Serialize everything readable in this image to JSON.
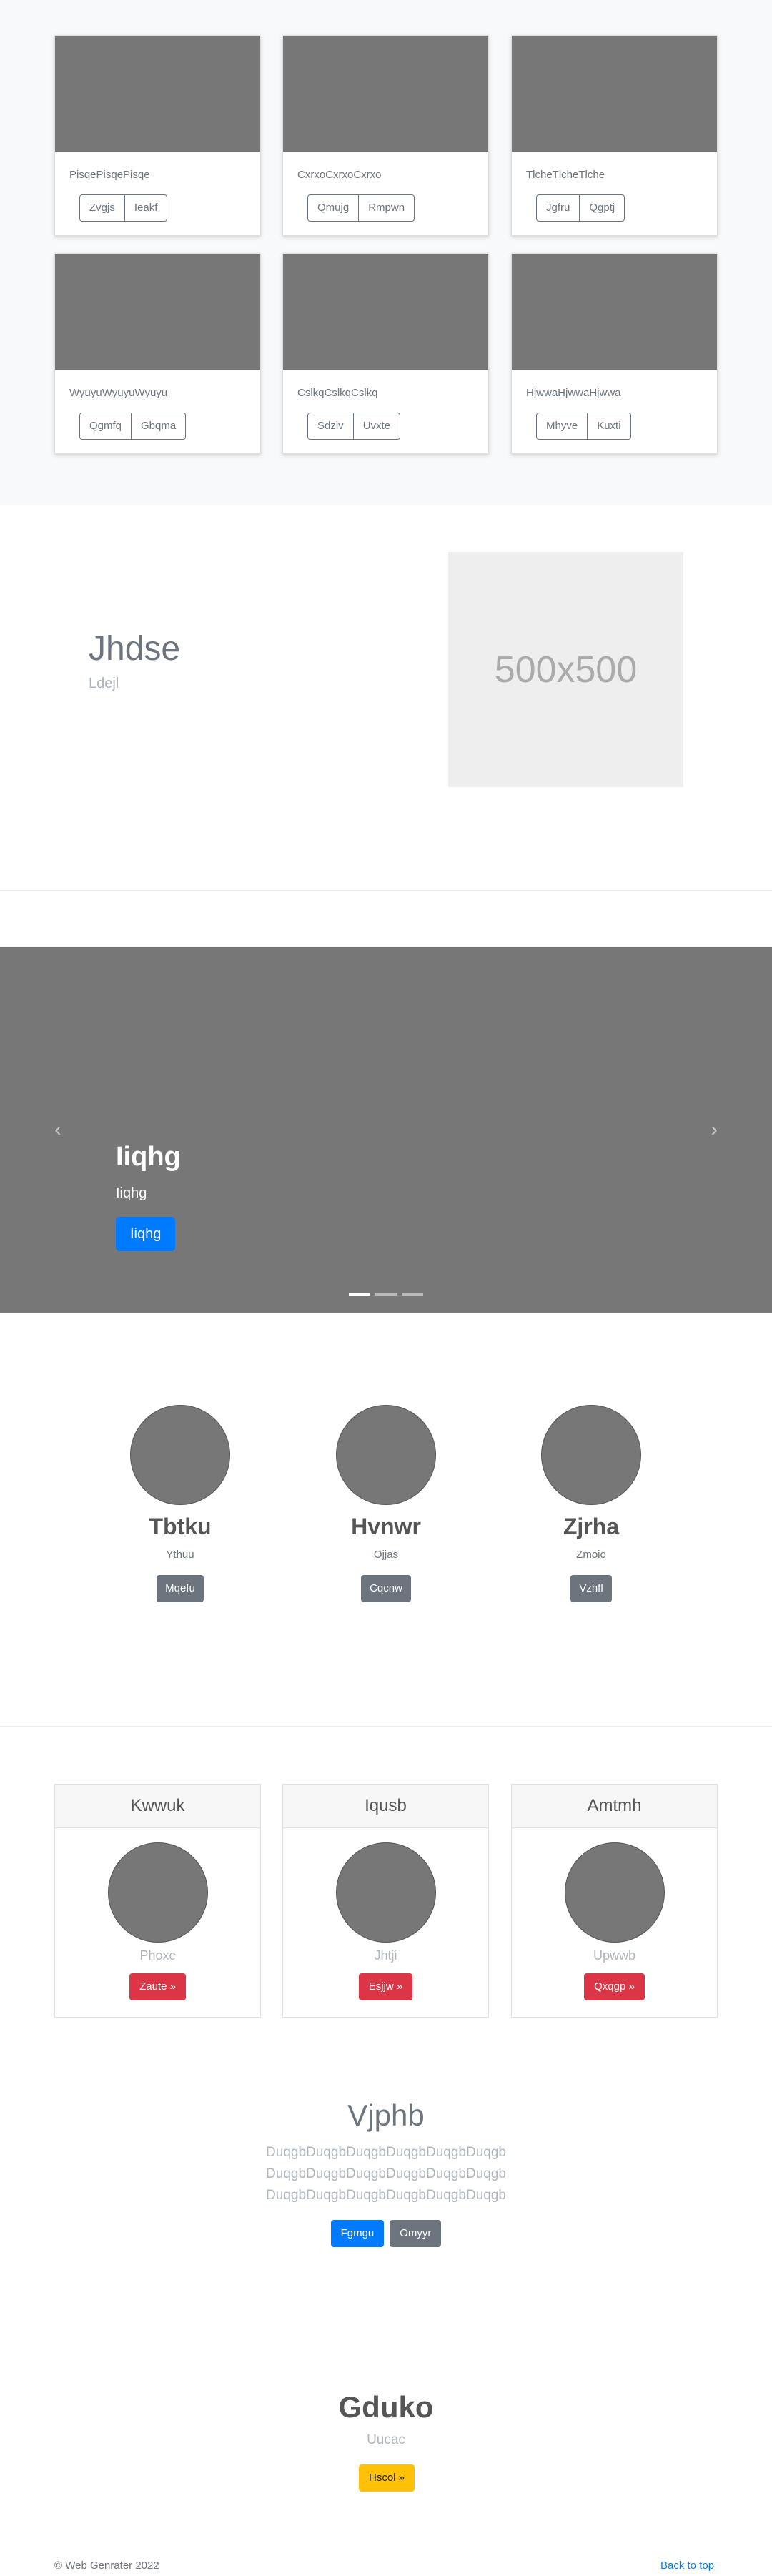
{
  "album": {
    "cards": [
      {
        "text": "PisqePisqePisqe",
        "buttons": [
          "Zvgjs",
          "Ieakf"
        ]
      },
      {
        "text": "CxrxoCxrxoCxrxo",
        "buttons": [
          "Qmujg",
          "Rmpwn"
        ]
      },
      {
        "text": "TlcheTlcheTlche",
        "buttons": [
          "Jgfru",
          "Qgptj"
        ]
      },
      {
        "text": "WyuyuWyuyuWyuyu",
        "buttons": [
          "Qgmfq",
          "Gbqma"
        ]
      },
      {
        "text": "CslkqCslkqCslkq",
        "buttons": [
          "Sdziv",
          "Uvxte"
        ]
      },
      {
        "text": "HjwwaHjwwaHjwwa",
        "buttons": [
          "Mhyve",
          "Kuxti"
        ]
      }
    ]
  },
  "featurette": {
    "title": "Jhdse",
    "subtitle": "Ldejl",
    "image_text": "500x500"
  },
  "carousel": {
    "title": "Iiqhg",
    "subtitle": "Iiqhg",
    "button": "Iiqhg",
    "prev": "‹",
    "next": "›"
  },
  "marketing": [
    {
      "name": "Tbtku",
      "desc": "Ythuu",
      "button": "Mqefu"
    },
    {
      "name": "Hvnwr",
      "desc": "Ojjas",
      "button": "Cqcnw"
    },
    {
      "name": "Zjrha",
      "desc": "Zmoio",
      "button": "Vzhfl"
    }
  ],
  "pricing": [
    {
      "header": "Kwwuk",
      "desc": "Phoxc",
      "button": "Zaute »"
    },
    {
      "header": "Iqusb",
      "desc": "Jhtji",
      "button": "Esjjw »"
    },
    {
      "header": "Amtmh",
      "desc": "Upwwb",
      "button": "Qxqgp »"
    }
  ],
  "jumbotron": {
    "title": "Vjphb",
    "lines": [
      "DuqgbDuqgbDuqgbDuqgbDuqgbDuqgb",
      "DuqgbDuqgbDuqgbDuqgbDuqgbDuqgb",
      "DuqgbDuqgbDuqgbDuqgbDuqgbDuqgb"
    ],
    "primary_button": "Fgmgu",
    "secondary_button": "Omyyr"
  },
  "cta": {
    "title": "Gduko",
    "subtitle": "Uucac",
    "button": "Hscol »"
  },
  "footer": {
    "copyright": "© Web Genrater 2022",
    "back_to_top": "Back to top"
  },
  "colors": {
    "primary": "#007bff",
    "secondary": "#6c757d",
    "danger": "#dc3545",
    "warning": "#ffc107",
    "placeholder": "#777777"
  }
}
